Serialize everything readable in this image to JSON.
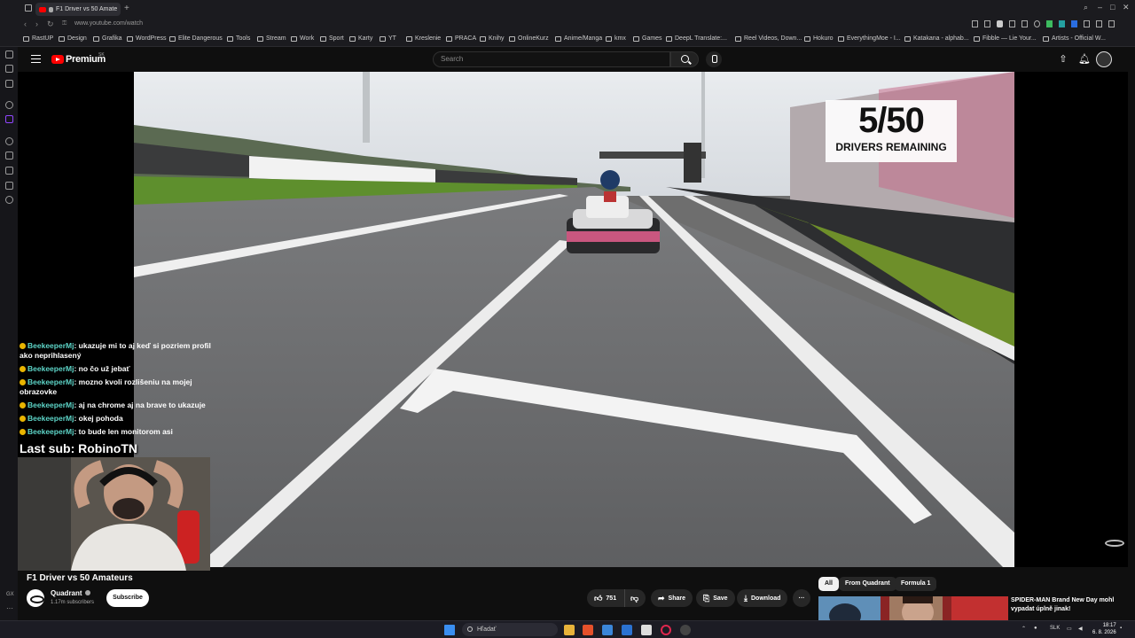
{
  "browser": {
    "tab_title": "F1 Driver vs 50 Amate",
    "url": "www.youtube.com/watch",
    "bookmarks": [
      "RastUP",
      "Design",
      "Grafika",
      "WordPress",
      "Elite Dangerous",
      "Tools",
      "Stream",
      "Work",
      "Sport",
      "Karty",
      "YT",
      "Kreslenie",
      "PRACA",
      "Knihy",
      "OnlineKurz",
      "Anime/Manga",
      "kmx",
      "Games",
      "DeepL Translate:...",
      "Reel Videos, Down...",
      "Hokuro",
      "EverythingMoe - I...",
      "Katakana - alphab...",
      "Fibble — Lie Your...",
      "Artists - Official W..."
    ]
  },
  "youtube": {
    "logo_text": "Premium",
    "logo_sup": "SK",
    "search_placeholder": "Search"
  },
  "video": {
    "overlay_count": "5/50",
    "overlay_label": "DRIVERS REMAINING",
    "title": "F1 Driver vs 50 Amateurs"
  },
  "chat": {
    "messages": [
      {
        "user": "BeekeeperMj",
        "text": ": ukazuje mi to aj keď si pozriem profil ako neprihlasený"
      },
      {
        "user": "BeekeeperMj",
        "text": ": no čo už jebať"
      },
      {
        "user": "BeekeeperMj",
        "text": ": mozno kvoli rozlišeniu na mojej obrazovke"
      },
      {
        "user": "BeekeeperMj",
        "text": ": aj na chrome aj na brave to ukazuje"
      },
      {
        "user": "BeekeeperMj",
        "text": ": okej pohoda"
      },
      {
        "user": "BeekeeperMj",
        "text": ": to bude len monitorom asi"
      }
    ],
    "last_sub": "Last sub: RobinoTN"
  },
  "channel": {
    "name": "Quadrant",
    "subscribers": "1.17m subscribers",
    "subscribe_label": "Subscribe"
  },
  "actions": {
    "likes": "751",
    "share": "Share",
    "save": "Save",
    "download": "Download",
    "more": "···"
  },
  "chips": [
    "All",
    "From Quadrant",
    "Formula 1"
  ],
  "recommendation": {
    "title": "SPIDER-MAN Brand New Day mohl vypadat úplně jinak!"
  },
  "taskbar": {
    "search_placeholder": "Hľadať",
    "lang": "SLK",
    "time": "18:17",
    "date": "6. 8. 2026"
  },
  "left_misc": {
    "gx": "GX"
  },
  "colors": {
    "youtube_red": "#ff0000",
    "chat_username": "#5dd4c7",
    "background": "#0f0f0f"
  }
}
